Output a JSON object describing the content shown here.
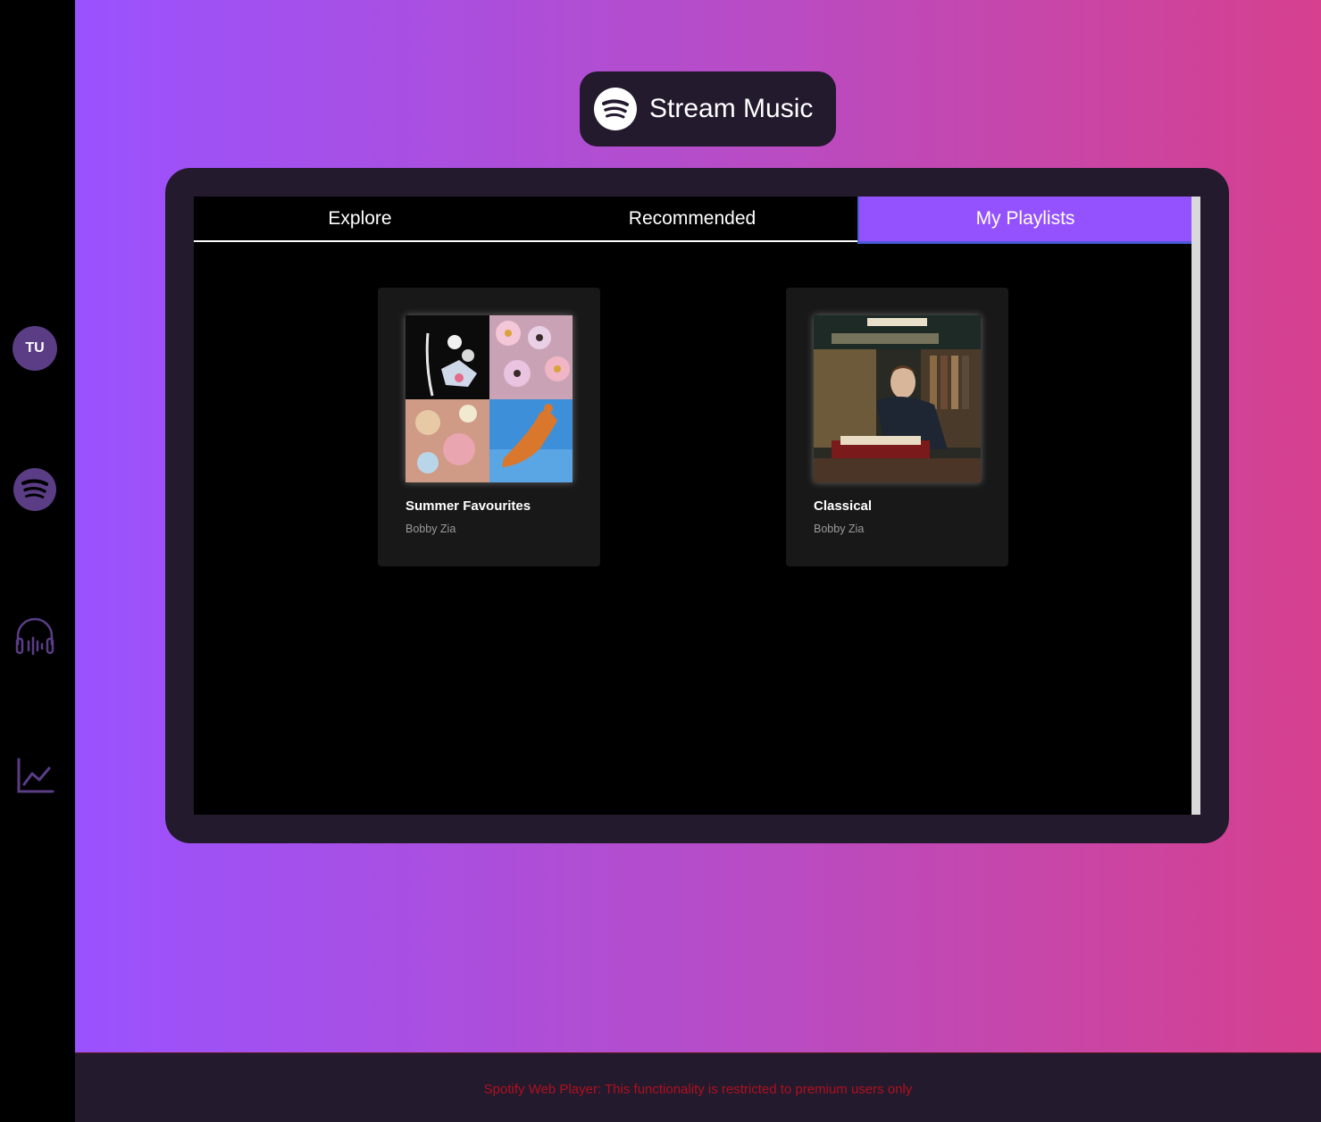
{
  "app": {
    "title": "Stream Music"
  },
  "sidebar": {
    "avatar_initials": "TU",
    "items": [
      {
        "icon": "spotify-icon"
      },
      {
        "icon": "headphones-icon"
      },
      {
        "icon": "chart-line-icon"
      }
    ]
  },
  "tabs": [
    {
      "label": "Explore",
      "active": false
    },
    {
      "label": "Recommended",
      "active": false
    },
    {
      "label": "My Playlists",
      "active": true
    }
  ],
  "playlists": [
    {
      "title": "Summer Favourites",
      "owner": "Bobby Zia"
    },
    {
      "title": "Classical",
      "owner": "Bobby Zia"
    }
  ],
  "footer": {
    "message": "Spotify Web Player: This functionality is restricted to premium users only"
  },
  "colors": {
    "accent": "#9452ff",
    "panel": "#241a2e",
    "error": "#b0101d"
  }
}
